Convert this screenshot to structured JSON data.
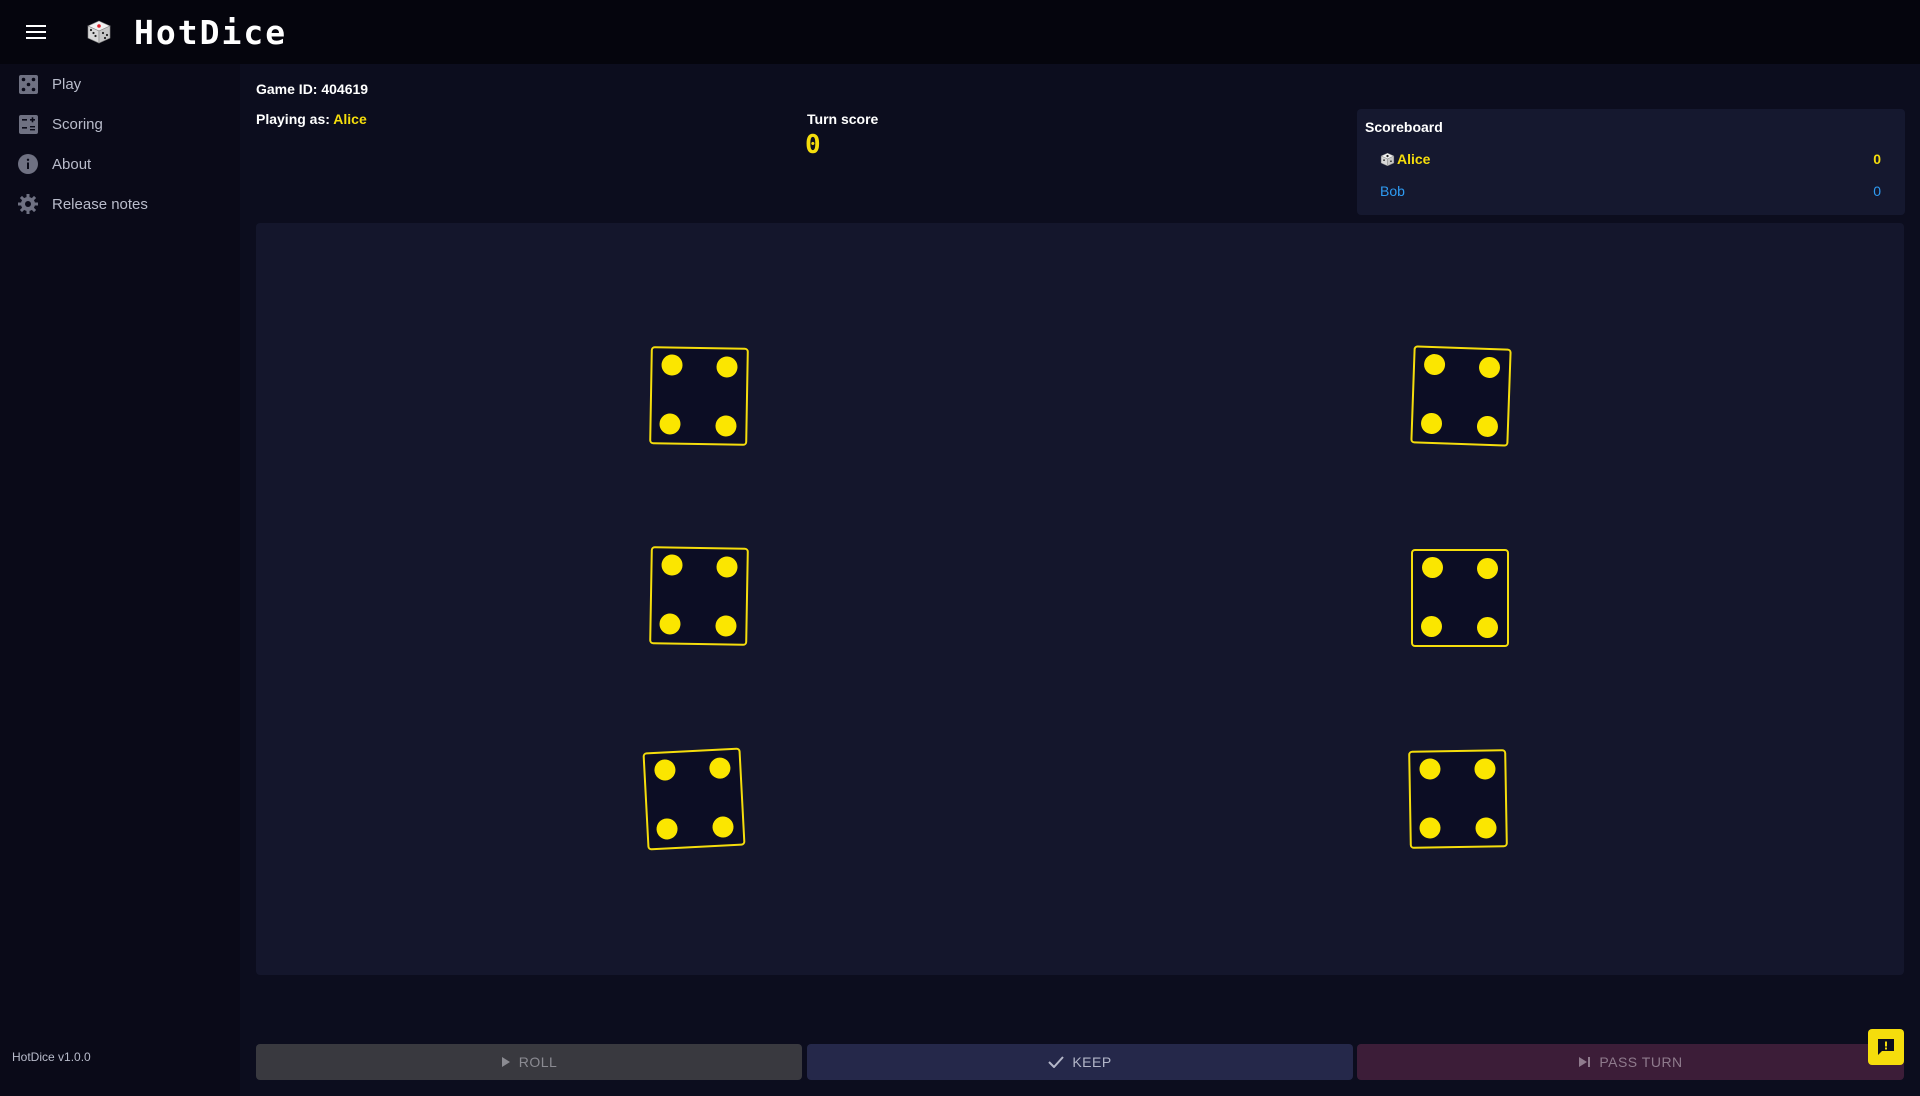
{
  "header": {
    "title": "HotDice",
    "menu_icon": "menu-icon",
    "logo_icon": "dice-icon"
  },
  "sidebar": {
    "items": [
      {
        "label": "Play",
        "icon": "dice-five-icon"
      },
      {
        "label": "Scoring",
        "icon": "scoring-icon"
      },
      {
        "label": "About",
        "icon": "info-icon"
      },
      {
        "label": "Release notes",
        "icon": "gear-icon"
      }
    ],
    "version": "HotDice v1.0.0"
  },
  "game": {
    "id_label": "Game ID: 404619",
    "playing_as_label": "Playing as:",
    "player": "Alice",
    "turn_score_label": "Turn score",
    "turn_score": "0"
  },
  "scoreboard": {
    "title": "Scoreboard",
    "players": [
      {
        "name": "Alice",
        "score": "0",
        "active": true,
        "color": "#f5dd0c"
      },
      {
        "name": "Bob",
        "score": "0",
        "active": false,
        "color": "#2e9bf2"
      }
    ]
  },
  "dice": [
    {
      "value": 4,
      "rotation": 1
    },
    {
      "value": 4,
      "rotation": 2
    },
    {
      "value": 4,
      "rotation": 1
    },
    {
      "value": 4,
      "rotation": 0
    },
    {
      "value": 4,
      "rotation": -3
    },
    {
      "value": 4,
      "rotation": -1
    }
  ],
  "actions": {
    "roll": "ROLL",
    "keep": "KEEP",
    "pass": "PASS TURN"
  },
  "colors": {
    "accent": "#f5dd0c",
    "secondary": "#2e9bf2",
    "background": "#0c0d1e"
  }
}
